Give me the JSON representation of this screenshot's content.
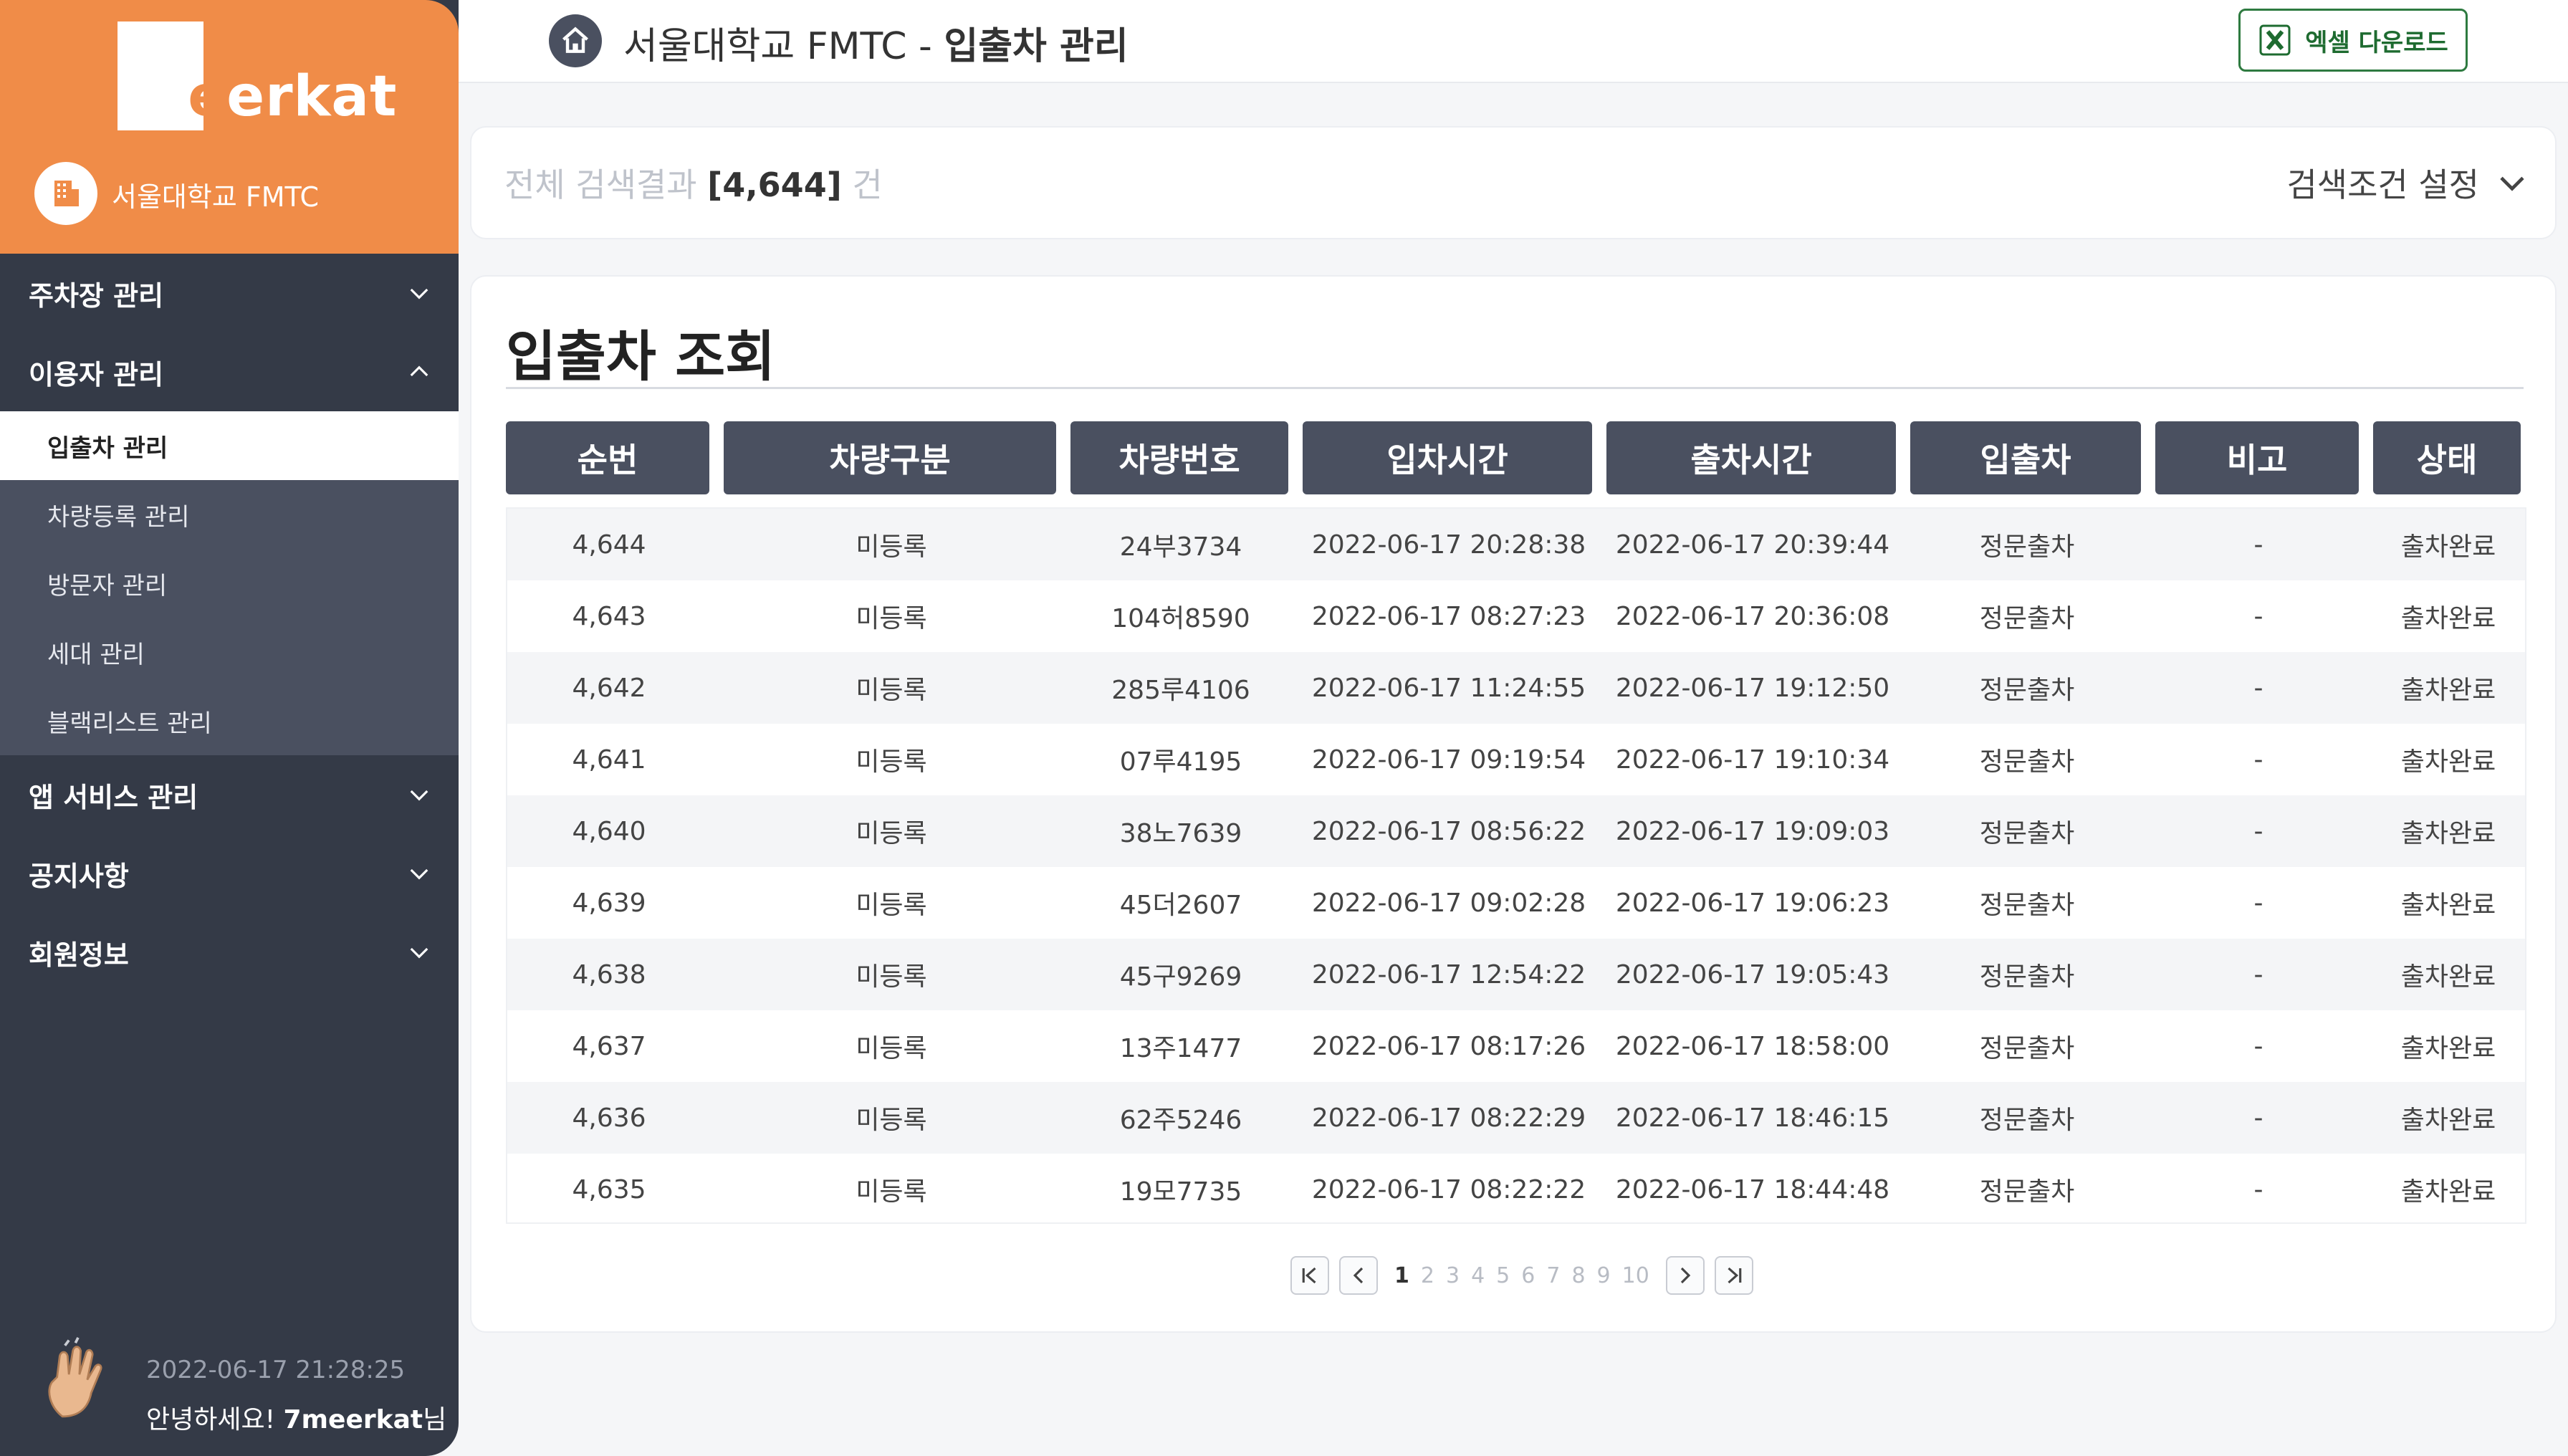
{
  "brand": {
    "logo_prefix": "m",
    "logo_accent": "e",
    "logo_suffix": "erkat",
    "org_name": "서울대학교 FMTC"
  },
  "sidebar": {
    "menus": [
      {
        "label": "주차장 관리"
      },
      {
        "label": "이용자 관리"
      },
      {
        "label": "앱 서비스 관리"
      },
      {
        "label": "공지사항"
      },
      {
        "label": "회원정보"
      }
    ],
    "sub_items": [
      {
        "label": "입출차 관리"
      },
      {
        "label": "차량등록 관리"
      },
      {
        "label": "방문자 관리"
      },
      {
        "label": "세대 관리"
      },
      {
        "label": "블랙리스트 관리"
      }
    ],
    "clock": "2022-06-17 21:28:25",
    "greet_prefix": "안녕하세요! ",
    "user": "7meerkat",
    "greet_suffix": "님"
  },
  "header": {
    "title_prefix": "서울대학교 FMTC - ",
    "title_main": "입출차 관리",
    "excel_label": "엑셀 다운로드"
  },
  "search": {
    "prefix": "전체 검색결과 ",
    "count": "[4,644]",
    "suffix": " 건",
    "setting_label": "검색조건 설정"
  },
  "main": {
    "title": "입출차 조회",
    "columns": [
      "순번",
      "차량구분",
      "차량번호",
      "입차시간",
      "출차시간",
      "입출차",
      "비고",
      "상태"
    ],
    "rows": [
      [
        "4,644",
        "미등록",
        "24부3734",
        "2022-06-17 20:28:38",
        "2022-06-17 20:39:44",
        "정문출차",
        "-",
        "출차완료"
      ],
      [
        "4,643",
        "미등록",
        "104허8590",
        "2022-06-17 08:27:23",
        "2022-06-17 20:36:08",
        "정문출차",
        "-",
        "출차완료"
      ],
      [
        "4,642",
        "미등록",
        "285루4106",
        "2022-06-17 11:24:55",
        "2022-06-17 19:12:50",
        "정문출차",
        "-",
        "출차완료"
      ],
      [
        "4,641",
        "미등록",
        "07루4195",
        "2022-06-17 09:19:54",
        "2022-06-17 19:10:34",
        "정문출차",
        "-",
        "출차완료"
      ],
      [
        "4,640",
        "미등록",
        "38노7639",
        "2022-06-17 08:56:22",
        "2022-06-17 19:09:03",
        "정문출차",
        "-",
        "출차완료"
      ],
      [
        "4,639",
        "미등록",
        "45더2607",
        "2022-06-17 09:02:28",
        "2022-06-17 19:06:23",
        "정문출차",
        "-",
        "출차완료"
      ],
      [
        "4,638",
        "미등록",
        "45구9269",
        "2022-06-17 12:54:22",
        "2022-06-17 19:05:43",
        "정문출차",
        "-",
        "출차완료"
      ],
      [
        "4,637",
        "미등록",
        "13주1477",
        "2022-06-17 08:17:26",
        "2022-06-17 18:58:00",
        "정문출차",
        "-",
        "출차완료"
      ],
      [
        "4,636",
        "미등록",
        "62주5246",
        "2022-06-17 08:22:29",
        "2022-06-17 18:46:15",
        "정문출차",
        "-",
        "출차완료"
      ],
      [
        "4,635",
        "미등록",
        "19모7735",
        "2022-06-17 08:22:22",
        "2022-06-17 18:44:48",
        "정문출차",
        "-",
        "출차완료"
      ]
    ]
  },
  "pagination": {
    "pages": [
      "1",
      "2",
      "3",
      "4",
      "5",
      "6",
      "7",
      "8",
      "9",
      "10"
    ],
    "current": "1"
  },
  "colors": {
    "brand_orange": "#f08c48",
    "sidebar_dark": "#343a47",
    "header_gray": "#4a5060",
    "excel_green": "#1e6b30"
  }
}
